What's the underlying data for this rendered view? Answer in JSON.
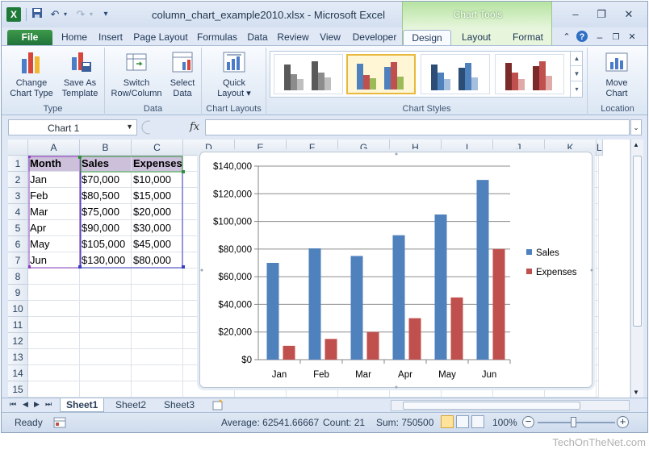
{
  "window": {
    "title": "column_chart_example2010.xlsx - Microsoft Excel",
    "contextual_tab_group": "Chart Tools"
  },
  "tabs": [
    "File",
    "Home",
    "Insert",
    "Page Layout",
    "Formulas",
    "Data",
    "Review",
    "View",
    "Developer",
    "Design",
    "Layout",
    "Format"
  ],
  "active_tab": "Design",
  "ribbon": {
    "groups": [
      {
        "label": "Type",
        "buttons": [
          {
            "line1": "Change",
            "line2": "Chart Type"
          },
          {
            "line1": "Save As",
            "line2": "Template"
          }
        ]
      },
      {
        "label": "Data",
        "buttons": [
          {
            "line1": "Switch",
            "line2": "Row/Column"
          },
          {
            "line1": "Select",
            "line2": "Data"
          }
        ]
      },
      {
        "label": "Chart Layouts",
        "buttons": [
          {
            "line1": "Quick",
            "line2": "Layout"
          }
        ]
      },
      {
        "label": "Chart Styles"
      },
      {
        "label": "Location",
        "buttons": [
          {
            "line1": "Move",
            "line2": "Chart"
          }
        ]
      }
    ]
  },
  "formula_bar": {
    "name_box": "Chart 1",
    "fx": "fx",
    "content": ""
  },
  "sheet": {
    "columns": [
      "A",
      "B",
      "C",
      "D",
      "E",
      "F",
      "G",
      "H",
      "I",
      "J",
      "K",
      "L"
    ],
    "rows": [
      "1",
      "2",
      "3",
      "4",
      "5",
      "6",
      "7",
      "8",
      "9",
      "10",
      "11",
      "12",
      "13",
      "14",
      "15"
    ],
    "table": [
      [
        "Month",
        "Sales",
        "Expenses"
      ],
      [
        "Jan",
        "$70,000",
        "$10,000"
      ],
      [
        "Feb",
        "$80,500",
        "$15,000"
      ],
      [
        "Mar",
        "$75,000",
        "$20,000"
      ],
      [
        "Apr",
        "$90,000",
        "$30,000"
      ],
      [
        "May",
        "$105,000",
        "$45,000"
      ],
      [
        "Jun",
        "$130,000",
        "$80,000"
      ]
    ]
  },
  "chart_data": {
    "type": "bar",
    "categories": [
      "Jan",
      "Feb",
      "Mar",
      "Apr",
      "May",
      "Jun"
    ],
    "series": [
      {
        "name": "Sales",
        "values": [
          70000,
          80500,
          75000,
          90000,
          105000,
          130000
        ],
        "color": "#4f81bd"
      },
      {
        "name": "Expenses",
        "values": [
          10000,
          15000,
          20000,
          30000,
          45000,
          80000
        ],
        "color": "#c0504d"
      }
    ],
    "ylim": [
      0,
      140000
    ],
    "yticks": [
      "$0",
      "$20,000",
      "$40,000",
      "$60,000",
      "$80,000",
      "$100,000",
      "$120,000",
      "$140,000"
    ],
    "grid": true,
    "legend": "right"
  },
  "sheet_tabs": [
    "Sheet1",
    "Sheet2",
    "Sheet3"
  ],
  "active_sheet": "Sheet1",
  "status": {
    "mode": "Ready",
    "average": "Average: 62541.66667",
    "count": "Count: 21",
    "sum": "Sum: 750500",
    "zoom": "100%"
  },
  "watermark": "TechOnTheNet.com",
  "colors": {
    "header_fill": "#ccc0da",
    "selection_border": "#4f3fbf",
    "file_tab": "#21733a"
  }
}
